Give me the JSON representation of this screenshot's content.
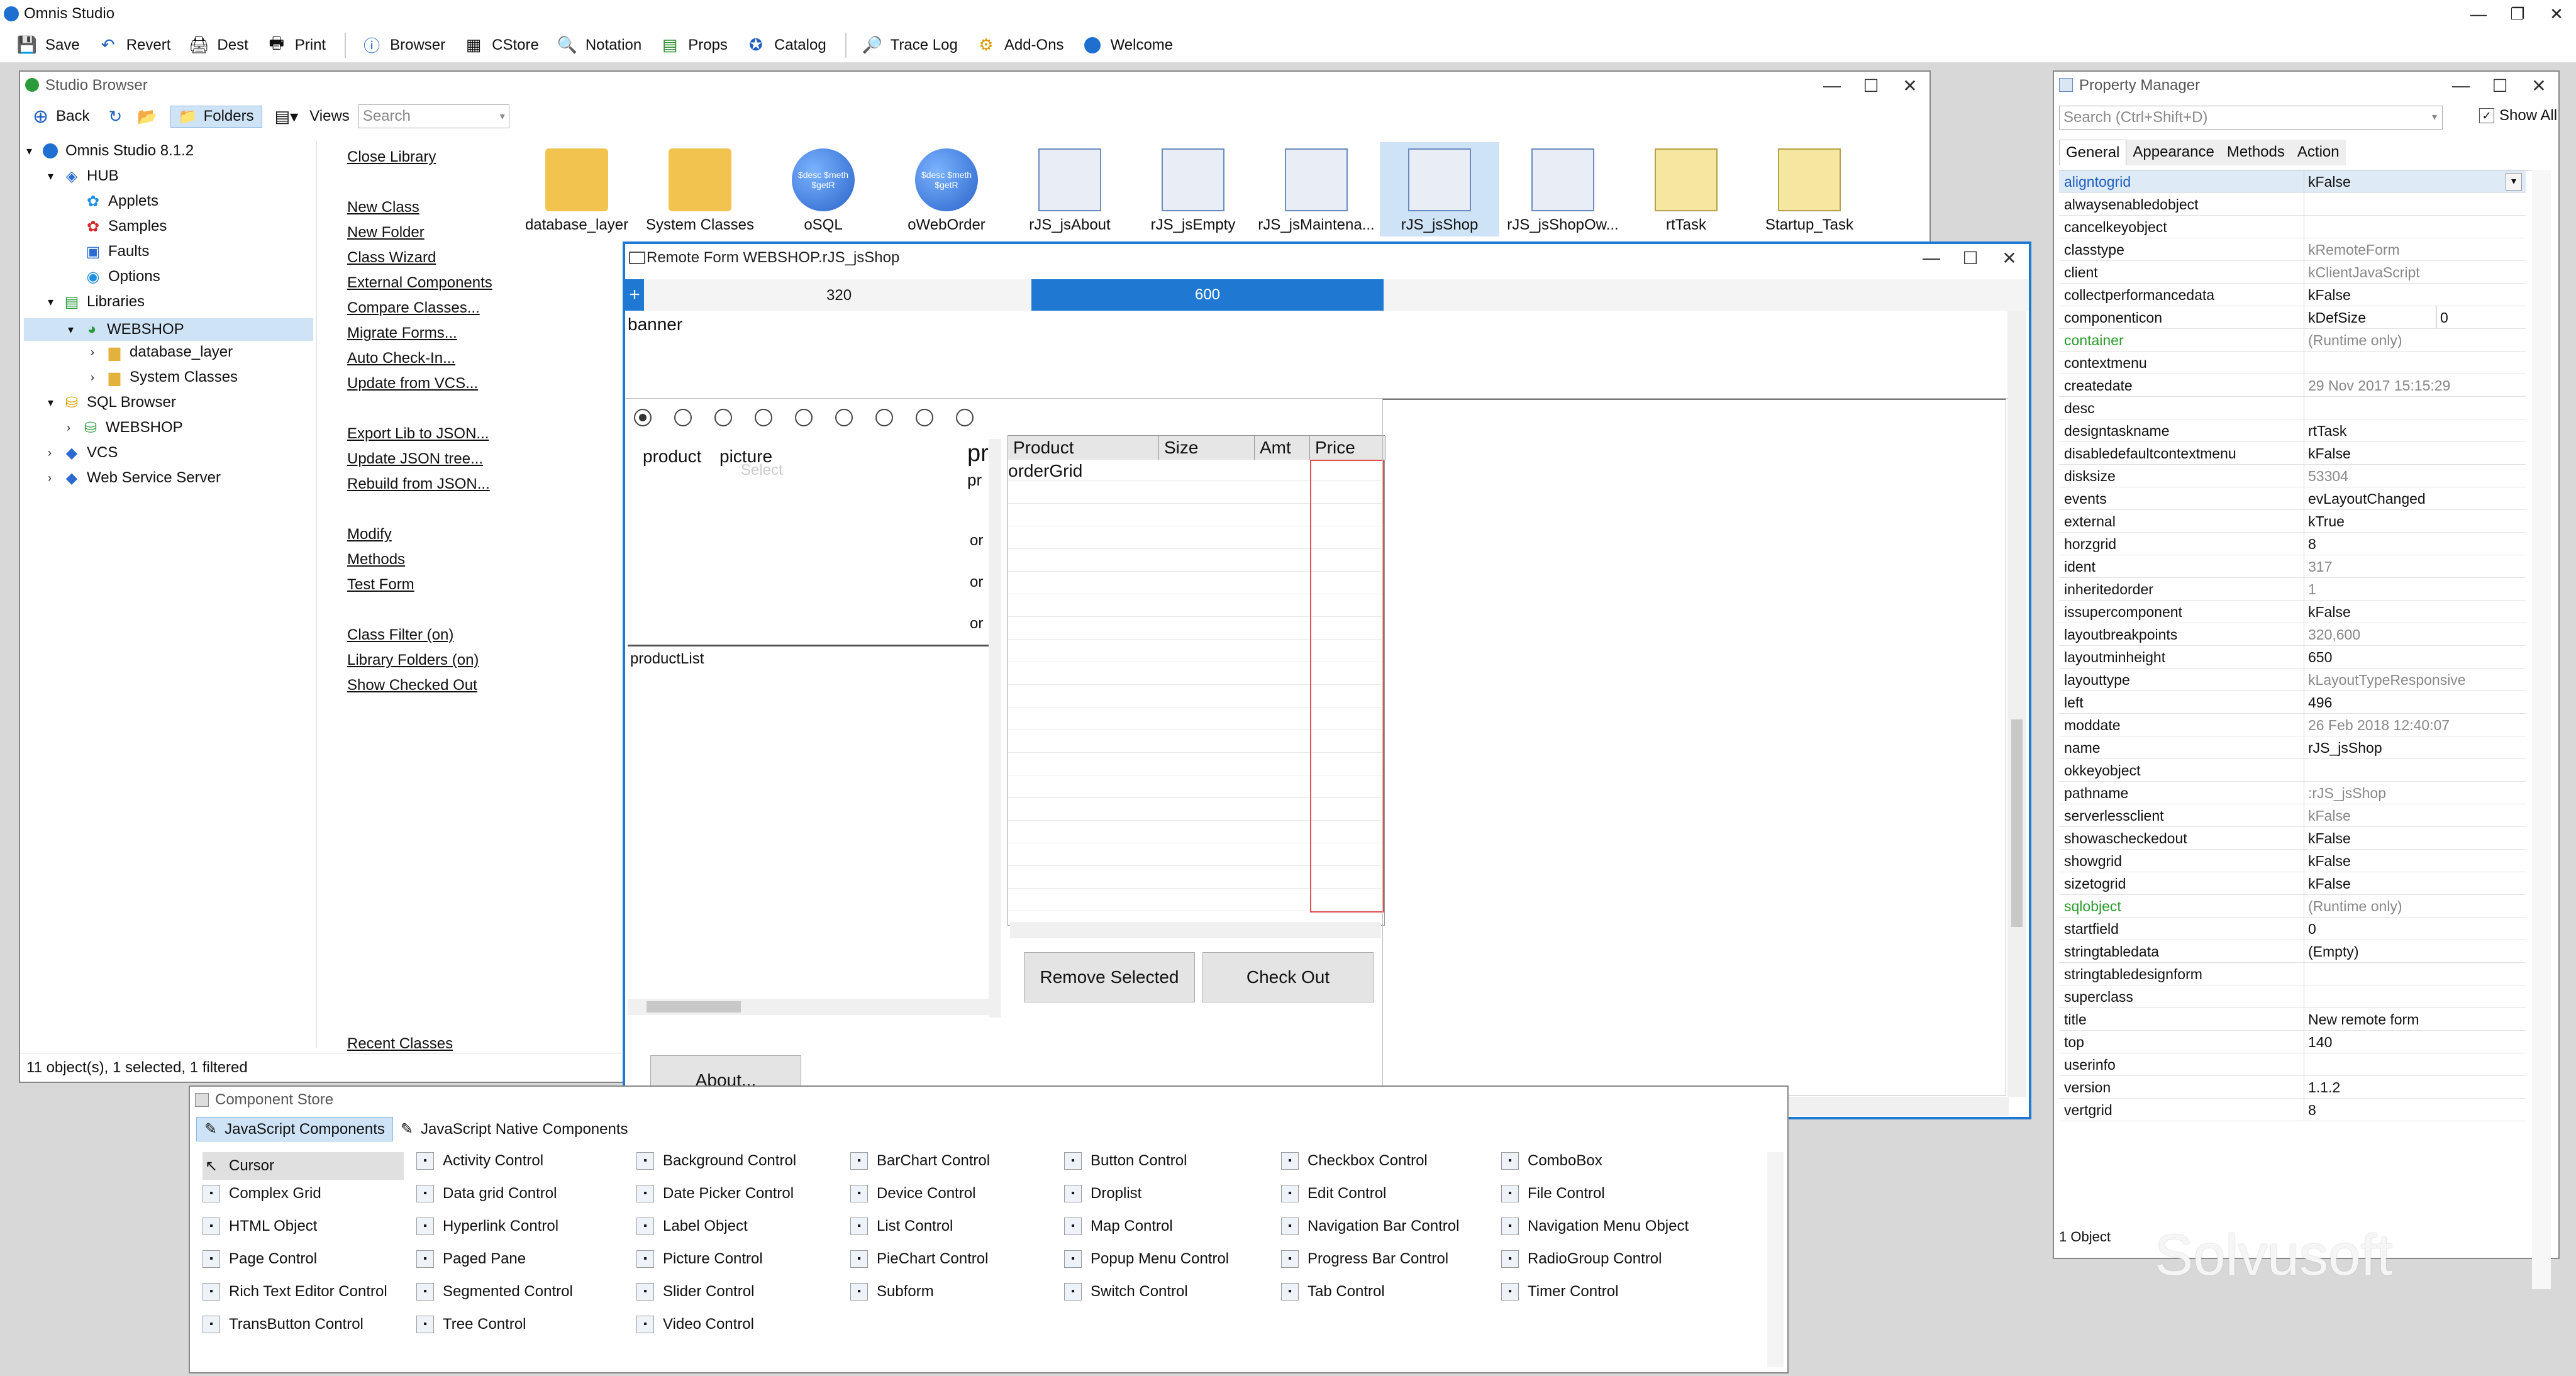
{
  "app": {
    "title": "Omnis Studio",
    "min": "—",
    "max": "❐",
    "close": "✕"
  },
  "toolbar": [
    {
      "icon": "save-icon",
      "label": "Save"
    },
    {
      "icon": "revert-icon",
      "label": "Revert"
    },
    {
      "icon": "dest-icon",
      "label": "Dest"
    },
    {
      "icon": "print-icon",
      "label": "Print"
    },
    {
      "icon": "browser-icon",
      "label": "Browser"
    },
    {
      "icon": "cstore-icon",
      "label": "CStore"
    },
    {
      "icon": "notation-icon",
      "label": "Notation"
    },
    {
      "icon": "props-icon",
      "label": "Props"
    },
    {
      "icon": "catalog-icon",
      "label": "Catalog"
    },
    {
      "icon": "tracelog-icon",
      "label": "Trace Log"
    },
    {
      "icon": "addons-icon",
      "label": "Add-Ons"
    },
    {
      "icon": "welcome-icon",
      "label": "Welcome"
    }
  ],
  "browser": {
    "title": "Studio Browser",
    "back": "Back",
    "folders": "Folders",
    "views": "Views",
    "search_placeholder": "Search",
    "tree": [
      {
        "label": "Omnis Studio 8.1.2",
        "icon": "omnis-icon"
      },
      {
        "label": "HUB",
        "icon": "hub-icon"
      },
      {
        "label": "Applets",
        "icon": "applets-icon"
      },
      {
        "label": "Samples",
        "icon": "samples-icon"
      },
      {
        "label": "Faults",
        "icon": "faults-icon"
      },
      {
        "label": "Options",
        "icon": "options-icon"
      },
      {
        "label": "Libraries",
        "icon": "libraries-icon"
      },
      {
        "label": "WEBSHOP",
        "icon": "library-icon"
      },
      {
        "label": "database_layer",
        "icon": "folder-icon"
      },
      {
        "label": "System Classes",
        "icon": "folder-icon"
      },
      {
        "label": "SQL Browser",
        "icon": "sql-icon"
      },
      {
        "label": "WEBSHOP",
        "icon": "database-icon"
      },
      {
        "label": "VCS",
        "icon": "vcs-icon"
      },
      {
        "label": "Web Service Server",
        "icon": "webservice-icon"
      }
    ],
    "links": [
      "Close Library",
      "New Class",
      "New Folder",
      "Class Wizard",
      "External Components",
      "Compare Classes...",
      "Migrate Forms...",
      "Auto Check-In...",
      "Update from VCS...",
      "Export Lib to JSON...",
      "Update JSON tree...",
      "Rebuild from JSON...",
      "Modify",
      "Methods",
      "Test Form",
      "Class Filter (on)",
      "Library Folders (on)",
      "Show Checked Out",
      "Recent Classes"
    ],
    "tiles": [
      {
        "label": "database_layer",
        "kind": "folder"
      },
      {
        "label": "System Classes",
        "kind": "folder"
      },
      {
        "label": "oSQL",
        "kind": "object",
        "glyph": "$desc $meth $getR"
      },
      {
        "label": "oWebOrder",
        "kind": "object",
        "glyph": "$desc $meth $getR"
      },
      {
        "label": "rJS_jsAbout",
        "kind": "remoteform"
      },
      {
        "label": "rJS_jsEmpty",
        "kind": "remoteform"
      },
      {
        "label": "rJS_jsMaintena...",
        "kind": "remoteform"
      },
      {
        "label": "rJS_jsShop",
        "kind": "remoteform"
      },
      {
        "label": "rJS_jsShopOw...",
        "kind": "remoteform"
      },
      {
        "label": "rtTask",
        "kind": "task"
      },
      {
        "label": "Startup_Task",
        "kind": "task"
      }
    ],
    "status": "11 object(s), 1 selected, 1 filtered"
  },
  "remote_form": {
    "title": "Remote Form WEBSHOP.rJS_jsShop",
    "breakpoints": [
      "320",
      "600"
    ],
    "banner": "banner",
    "list_headers": [
      "product",
      "picture"
    ],
    "list_hint": "Select",
    "list_cut": [
      "pr",
      "pr",
      "or",
      "or",
      "or"
    ],
    "product_list": "productList",
    "grid_headers": [
      "Product",
      "Size",
      "Amt",
      "Price"
    ],
    "grid_name": "orderGrid",
    "remove_btn": "Remove Selected",
    "checkout_btn": "Check Out",
    "about_btn": "About..."
  },
  "props": {
    "title": "Property Manager",
    "search_placeholder": "Search (Ctrl+Shift+D)",
    "show_all": "Show All",
    "tabs": [
      "General",
      "Appearance",
      "Methods",
      "Action"
    ],
    "rows": [
      {
        "k": "aligntogrid",
        "v": "kFalse",
        "sel": true
      },
      {
        "k": "alwaysenabledobject",
        "v": ""
      },
      {
        "k": "cancelkeyobject",
        "v": ""
      },
      {
        "k": "classtype",
        "v": "kRemoteForm",
        "grey": true
      },
      {
        "k": "client",
        "v": "kClientJavaScript",
        "grey": true
      },
      {
        "k": "collectperformancedata",
        "v": "kFalse"
      },
      {
        "k": "componenticon",
        "v": "kDefSize",
        "v2": "0"
      },
      {
        "k": "container",
        "v": "(Runtime only)",
        "green": true,
        "grey": true
      },
      {
        "k": "contextmenu",
        "v": ""
      },
      {
        "k": "createdate",
        "v": "29 Nov 2017   15:15:29",
        "grey": true
      },
      {
        "k": "desc",
        "v": ""
      },
      {
        "k": "designtaskname",
        "v": "rtTask"
      },
      {
        "k": "disabledefaultcontextmenu",
        "v": "kFalse"
      },
      {
        "k": "disksize",
        "v": "53304",
        "grey": true
      },
      {
        "k": "events",
        "v": "evLayoutChanged"
      },
      {
        "k": "external",
        "v": "kTrue"
      },
      {
        "k": "horzgrid",
        "v": "8"
      },
      {
        "k": "ident",
        "v": "317",
        "grey": true
      },
      {
        "k": "inheritedorder",
        "v": "1",
        "grey": true
      },
      {
        "k": "issupercomponent",
        "v": "kFalse"
      },
      {
        "k": "layoutbreakpoints",
        "v": "320,600",
        "grey": true
      },
      {
        "k": "layoutminheight",
        "v": "650"
      },
      {
        "k": "layouttype",
        "v": "kLayoutTypeResponsive",
        "grey": true
      },
      {
        "k": "left",
        "v": "496"
      },
      {
        "k": "moddate",
        "v": "26 Feb 2018   12:40:07",
        "grey": true
      },
      {
        "k": "name",
        "v": "rJS_jsShop"
      },
      {
        "k": "okkeyobject",
        "v": ""
      },
      {
        "k": "pathname",
        "v": ":rJS_jsShop",
        "grey": true
      },
      {
        "k": "serverlessclient",
        "v": "kFalse",
        "grey": true
      },
      {
        "k": "showascheckedout",
        "v": "kFalse"
      },
      {
        "k": "showgrid",
        "v": "kFalse"
      },
      {
        "k": "sizetogrid",
        "v": "kFalse"
      },
      {
        "k": "sqlobject",
        "v": "(Runtime only)",
        "green": true,
        "grey": true
      },
      {
        "k": "startfield",
        "v": "0"
      },
      {
        "k": "stringtabledata",
        "v": "(Empty)"
      },
      {
        "k": "stringtabledesignform",
        "v": ""
      },
      {
        "k": "superclass",
        "v": ""
      },
      {
        "k": "title",
        "v": "New remote form"
      },
      {
        "k": "top",
        "v": "140"
      },
      {
        "k": "userinfo",
        "v": ""
      },
      {
        "k": "version",
        "v": "1.1.2"
      },
      {
        "k": "vertgrid",
        "v": "8"
      }
    ],
    "status": "1 Object",
    "watermark": "Solvusoft"
  },
  "store": {
    "title": "Component Store",
    "tabs": [
      "JavaScript Components",
      "JavaScript Native Components"
    ],
    "items": [
      [
        "Cursor",
        "Complex Grid",
        "HTML Object",
        "Page Control",
        "Rich Text Editor Control",
        "TransButton Control"
      ],
      [
        "Activity Control",
        "Data grid Control",
        "Hyperlink Control",
        "Paged Pane",
        "Segmented Control",
        "Tree Control"
      ],
      [
        "Background Control",
        "Date Picker Control",
        "Label Object",
        "Picture Control",
        "Slider Control",
        "Video Control"
      ],
      [
        "BarChart Control",
        "Device Control",
        "List Control",
        "PieChart Control",
        "Subform"
      ],
      [
        "Button Control",
        "Droplist",
        "Map Control",
        "Popup Menu Control",
        "Switch Control"
      ],
      [
        "Checkbox Control",
        "Edit Control",
        "Navigation Bar Control",
        "Progress Bar Control",
        "Tab Control"
      ],
      [
        "ComboBox",
        "File Control",
        "Navigation Menu Object",
        "RadioGroup Control",
        "Timer Control"
      ]
    ]
  }
}
